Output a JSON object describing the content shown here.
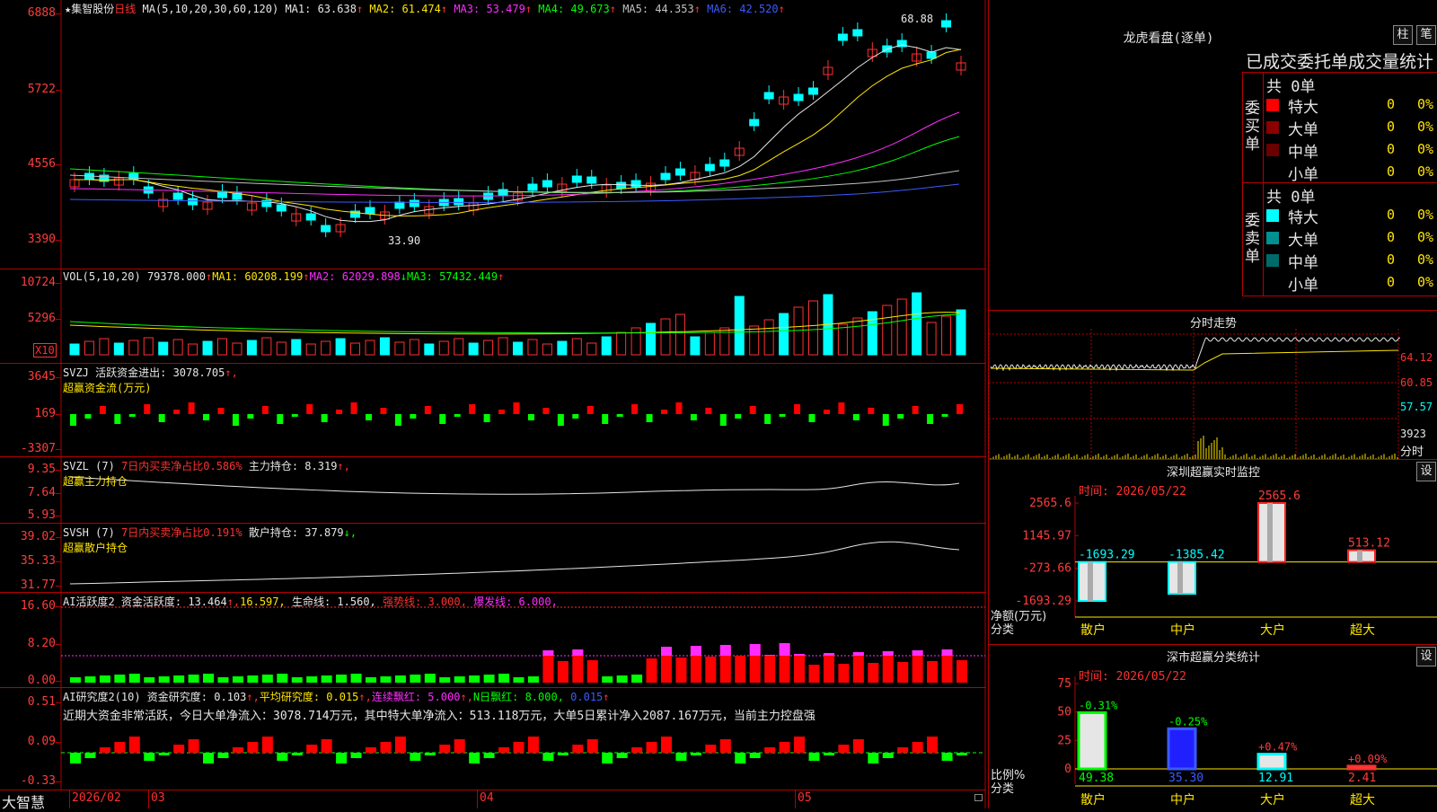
{
  "stock": {
    "star": "★",
    "name": "集智股份",
    "period": "日线"
  },
  "ma_header": {
    "params": "MA(5,10,20,30,60,120)",
    "items": [
      {
        "label": "MA1:",
        "value": "63.638",
        "arrow": "↑",
        "color": "#e6e6e6"
      },
      {
        "label": "MA2:",
        "value": "61.474",
        "arrow": "↑",
        "color": "#ffe600"
      },
      {
        "label": "MA3:",
        "value": "53.479",
        "arrow": "↑",
        "color": "#ff2cff"
      },
      {
        "label": "MA4:",
        "value": "49.673",
        "arrow": "↑",
        "color": "#00ff00"
      },
      {
        "label": "MA5:",
        "value": "44.353",
        "arrow": "↑",
        "color": "#c0c0c0"
      },
      {
        "label": "MA6:",
        "value": "42.520",
        "arrow": "↑",
        "color": "#3b5bff"
      }
    ]
  },
  "price_axis": [
    "6888",
    "5722",
    "4556",
    "3390"
  ],
  "price_annotations": {
    "high": "68.88",
    "low": "33.90"
  },
  "vol_header": {
    "params": "VOL(5,10,20)",
    "value": "79378.000",
    "arrow1": "↑",
    "ma1": "MA1: 60208.199",
    "arrow2": "↑",
    "ma2": "MA2: 62029.898",
    "arrow3": "↓",
    "ma3": "MA3: 57432.449",
    "arrow4": "↑"
  },
  "vol_axis": [
    "10724",
    "5296"
  ],
  "vol_unit": "X10",
  "svzj": {
    "label": "SVZJ  活跃资金进出: 3078.705",
    "arrow": "↑,",
    "sub": "超赢资金流(万元)",
    "axis": [
      "3645",
      "169",
      "-3307"
    ]
  },
  "svzl": {
    "label": "SVZL (7)",
    "mid": "7日内买卖净占比0.586%",
    "main": "主力持仓: 8.319",
    "arrow": "↑,",
    "sub": "超赢主力持仓",
    "axis": [
      "9.35",
      "7.64",
      "5.93"
    ]
  },
  "svsh": {
    "label": "SVSH (7)",
    "mid": "7日内买卖净占比0.191%",
    "main": "散户持仓: 37.879",
    "arrow": "↓,",
    "sub": "超赢散户持仓",
    "axis": [
      "39.02",
      "35.33",
      "31.77"
    ]
  },
  "ai1": {
    "label": "AI活跃度2 资金活跃度: 13.464",
    "a1": "↑,",
    "v2": "16.597,",
    "v3": "生命线: 1.560,",
    "v4": "强势线: 3.000,",
    "v5": "爆发线: 6.000,",
    "axis": [
      "16.60",
      "8.20",
      "0.00"
    ]
  },
  "ai2": {
    "label": "AI研究度2(10) 资金研究度: 0.103",
    "a1": "↑,",
    "v2": "平均研究度: 0.015",
    "a2": "↑,",
    "v3": "连续飘红: 5.000",
    "a3": "↑,",
    "v4": "N日飘红: 8.000,",
    "v5": "0.015",
    "a5": "↑",
    "note": "近期大资金非常活跃，今日大单净流入：3078.714万元，其中特大单净流入：513.118万元，大单5日累计净入2087.167万元，当前主力控盘强",
    "axis": [
      "0.51",
      "0.09",
      "-0.33"
    ]
  },
  "bottom": {
    "brand": "大智慧",
    "dates": [
      "2026/02",
      "03",
      "04",
      "05"
    ]
  },
  "lhb": {
    "title": "龙虎看盘(逐单)",
    "btn1": "柱",
    "btn2": "笔",
    "subtitle": "已成交委托单成交量统计",
    "buy": {
      "side": "委买单",
      "total": "共 0单",
      "rows": [
        {
          "label": "特大",
          "val": "0",
          "pct": "0%",
          "color": "#ff0000"
        },
        {
          "label": "大单",
          "val": "0",
          "pct": "0%",
          "color": "#8b0000"
        },
        {
          "label": "中单",
          "val": "0",
          "pct": "0%",
          "color": "#6a0000"
        },
        {
          "label": "小单",
          "val": "0",
          "pct": "0%",
          "color": "#000000"
        }
      ]
    },
    "sell": {
      "side": "委卖单",
      "total": "共 0单",
      "rows": [
        {
          "label": "特大",
          "val": "0",
          "pct": "0%",
          "color": "#00ffff"
        },
        {
          "label": "大单",
          "val": "0",
          "pct": "0%",
          "color": "#009090"
        },
        {
          "label": "中单",
          "val": "0",
          "pct": "0%",
          "color": "#006a6a"
        },
        {
          "label": "小单",
          "val": "0",
          "pct": "0%",
          "color": "#000000"
        }
      ]
    }
  },
  "intraday": {
    "title": "分时走势",
    "axis": [
      "64.12",
      "60.85",
      "57.57"
    ],
    "vol": "3923",
    "vol_label": "分时"
  },
  "sz_monitor": {
    "title": "深圳超赢实时监控",
    "btn": "设",
    "time": "时间: 2026/05/22",
    "axis": [
      "2565.6",
      "1145.97",
      "-273.66",
      "-1693.29"
    ],
    "ylabel1": "净额(万元)",
    "ylabel2": "分类"
  },
  "sz_stats": {
    "title": "深市超赢分类统计",
    "btn": "设",
    "time": "时间: 2026/05/22",
    "axis": [
      "75",
      "50",
      "25",
      "0"
    ],
    "ylabel1": "比例%",
    "ylabel2": "分类"
  },
  "chart_data": [
    {
      "type": "bar",
      "title": "深圳超赢实时监控",
      "categories": [
        "散户",
        "中户",
        "大户",
        "超大"
      ],
      "values": [
        -1693.29,
        -1385.42,
        2565.6,
        513.12
      ],
      "labels": [
        "-1693.29",
        "-1385.42",
        "2565.6",
        "513.12"
      ],
      "ylim": [
        -1693.29,
        2565.6
      ],
      "ylabel": "净额(万元)",
      "xlabel": "分类"
    },
    {
      "type": "bar",
      "title": "深市超赢分类统计",
      "categories": [
        "散户",
        "中户",
        "大户",
        "超大"
      ],
      "values": [
        49.38,
        35.3,
        12.91,
        2.41
      ],
      "changes": [
        "-0.31%",
        "-0.25%",
        "+0.47%",
        "+0.09%"
      ],
      "ylim": [
        0,
        75
      ],
      "ylabel": "比例%",
      "xlabel": "分类"
    }
  ]
}
